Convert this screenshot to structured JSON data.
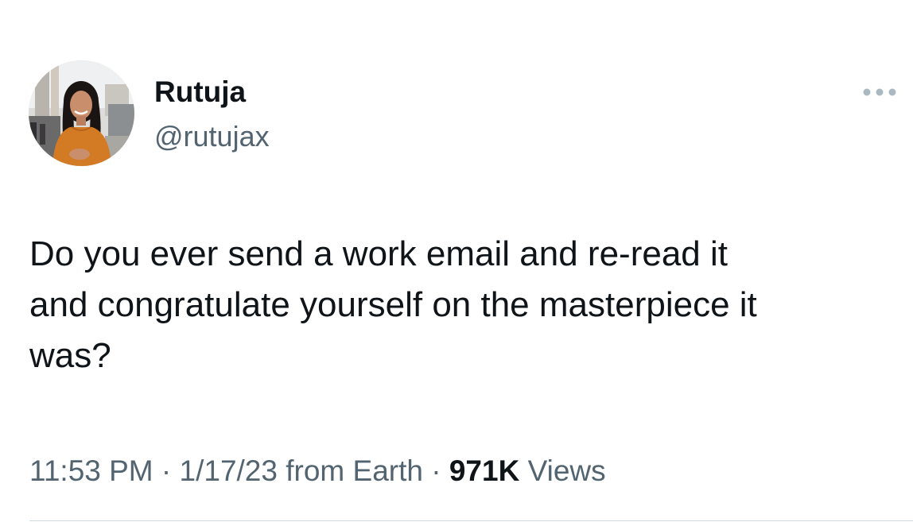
{
  "author": {
    "name": "Rutuja",
    "handle": "@rutujax"
  },
  "tweet": {
    "text": "Do you ever send a work email and re-read it\nand congratulate yourself on the masterpiece it\nwas?"
  },
  "meta": {
    "time": "11:53 PM",
    "separator": "·",
    "date": "1/17/23",
    "source": "from Earth",
    "views_count": "971K",
    "views_label": "Views"
  },
  "icons": {
    "more": "more-horizontal-icon",
    "avatar": "profile-photo"
  },
  "colors": {
    "text_primary": "#0f1419",
    "text_secondary": "#536471",
    "divider": "#cfd9de",
    "more_icon": "#aab8c2"
  }
}
